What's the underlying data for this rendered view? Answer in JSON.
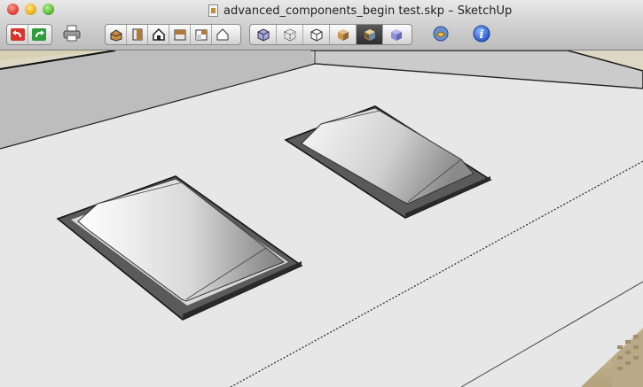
{
  "window": {
    "title": "advanced_components_begin test.skp – SketchUp"
  },
  "toolbar": {
    "undo_redo": [
      "undo-icon",
      "redo-icon"
    ],
    "print": "printer-icon",
    "views": [
      "iso-view-icon",
      "top-view-icon",
      "front-view-icon",
      "right-view-icon",
      "back-view-icon",
      "left-view-icon"
    ],
    "styles": [
      "xray-icon",
      "wireframe-icon",
      "hidden-line-icon",
      "shaded-icon",
      "shaded-textures-icon",
      "monochrome-icon"
    ],
    "active_style": "shaded-textures-icon",
    "extra": [
      "components-icon",
      "info-icon"
    ]
  },
  "scene": {
    "model": "roof with two skylights",
    "colors": {
      "sky": "#e4e4e4",
      "roof": "#e6e6e6",
      "parapet": "#c8c8c8",
      "curb": "#5a5a5a",
      "ground": "#d9d2b0",
      "building": "#c8b99a"
    }
  }
}
